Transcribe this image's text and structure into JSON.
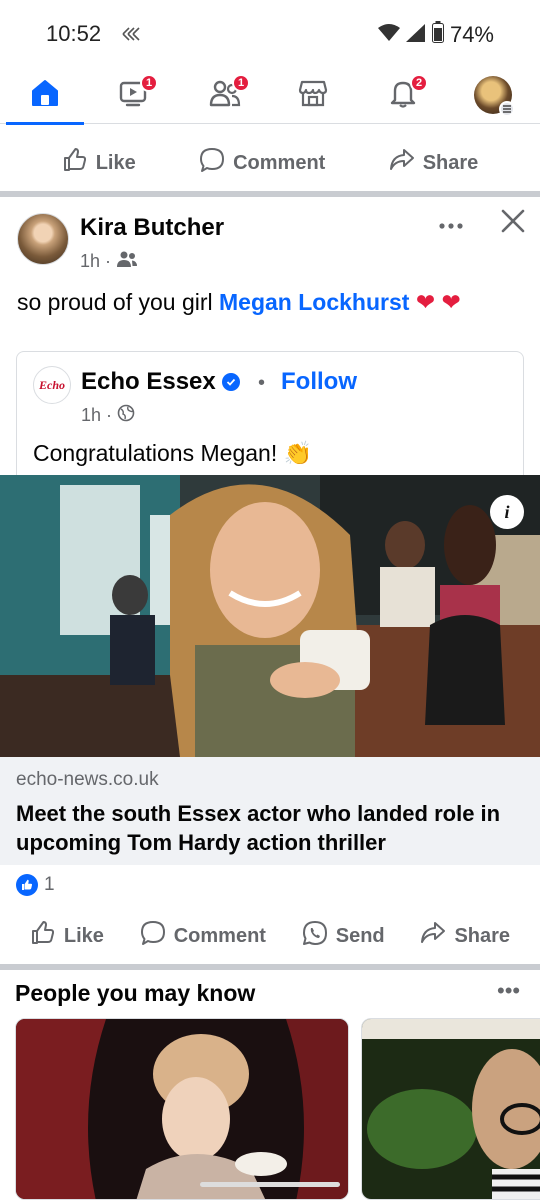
{
  "status_bar": {
    "time": "10:52",
    "battery": "74%"
  },
  "nav": {
    "video_badge": "1",
    "friends_badge": "1",
    "notifications_badge": "2"
  },
  "prev_actions": {
    "like": "Like",
    "comment": "Comment",
    "share": "Share"
  },
  "post": {
    "author": "Kira Butcher",
    "time": "1h",
    "text_prefix": "so proud of you girl ",
    "mention": "Megan Lockhurst",
    "emoji_inline": "❤",
    "emoji_wrap": "❤",
    "shared": {
      "logo_text": "Echo",
      "page_name": "Echo Essex",
      "separator": "•",
      "follow": "Follow",
      "time": "1h",
      "text": "Congratulations Megan! 👏"
    },
    "info_label": "i",
    "link": {
      "domain": "echo-news.co.uk",
      "title": "Meet the south Essex actor who landed role in upcoming Tom Hardy action thriller"
    },
    "reaction_count": "1",
    "actions": {
      "like": "Like",
      "comment": "Comment",
      "send": "Send",
      "share": "Share"
    }
  },
  "pymk": {
    "title": "People you may know",
    "more": "•••"
  },
  "colors": {
    "accent": "#0866ff",
    "badge": "#e41e3f",
    "muted": "#65676b"
  }
}
